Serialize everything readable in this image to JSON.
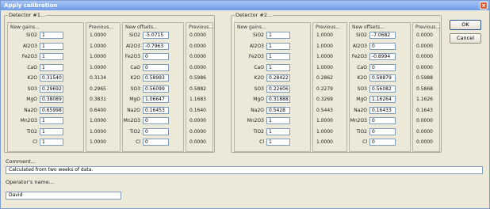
{
  "window": {
    "title": "Apply calibration"
  },
  "buttons": {
    "ok": "OK",
    "cancel": "Cancel"
  },
  "detectors": [
    {
      "title": "Detector #1...",
      "gains_header": "New gains...",
      "prev_header": "Previous...",
      "offsets_header": "New offsets...",
      "prev2_header": "Previous...",
      "rows": [
        {
          "el": "SiO2",
          "gain": "1",
          "gprev": "1.0000",
          "offset": "-5.0715",
          "oprev": "0.0000"
        },
        {
          "el": "Al2O3",
          "gain": "1",
          "gprev": "1.0000",
          "offset": "-0.7963",
          "oprev": "0.0000"
        },
        {
          "el": "Fe2O3",
          "gain": "1",
          "gprev": "1.0000",
          "offset": "0",
          "oprev": "0.0000"
        },
        {
          "el": "CaO",
          "gain": "1",
          "gprev": "1.0000",
          "offset": "0",
          "oprev": "0.0000"
        },
        {
          "el": "K2O",
          "gain": "0.31540",
          "gprev": "0.3134",
          "offset": "0.58993",
          "oprev": "0.5986"
        },
        {
          "el": "SO3",
          "gain": "0.29692",
          "gprev": "0.2965",
          "offset": "0.56099",
          "oprev": "0.5882"
        },
        {
          "el": "MgO",
          "gain": "0.38089",
          "gprev": "0.3831",
          "offset": "1.06647",
          "oprev": "1.1683"
        },
        {
          "el": "Na2O",
          "gain": "0.65998",
          "gprev": "0.6400",
          "offset": "0.16453",
          "oprev": "0.1640"
        },
        {
          "el": "Mn2O3",
          "gain": "1",
          "gprev": "1.0000",
          "offset": "0",
          "oprev": "0.0000"
        },
        {
          "el": "TiO2",
          "gain": "1",
          "gprev": "1.0000",
          "offset": "0",
          "oprev": "0.0000"
        },
        {
          "el": "Cl",
          "gain": "1",
          "gprev": "1.0000",
          "offset": "0",
          "oprev": "0.0000"
        }
      ]
    },
    {
      "title": "Detector #2...",
      "gains_header": "New gains...",
      "prev_header": "Previous...",
      "offsets_header": "New offsets...",
      "prev2_header": "Previous...",
      "rows": [
        {
          "el": "SiO2",
          "gain": "1",
          "gprev": "1.0000",
          "offset": "-7.0682",
          "oprev": "0.0000"
        },
        {
          "el": "Al2O3",
          "gain": "1",
          "gprev": "1.0000",
          "offset": "0",
          "oprev": "0.0000"
        },
        {
          "el": "Fe2O3",
          "gain": "1",
          "gprev": "1.0000",
          "offset": "-0.8994",
          "oprev": "0.0000"
        },
        {
          "el": "CaO",
          "gain": "1",
          "gprev": "1.0000",
          "offset": "0",
          "oprev": "0.0000"
        },
        {
          "el": "K2O",
          "gain": "0.28422",
          "gprev": "0.2862",
          "offset": "0.58879",
          "oprev": "0.5988"
        },
        {
          "el": "SO3",
          "gain": "0.22606",
          "gprev": "0.2279",
          "offset": "0.56082",
          "oprev": "0.5868"
        },
        {
          "el": "MgO",
          "gain": "0.31888",
          "gprev": "0.3269",
          "offset": "1.16264",
          "oprev": "1.1626"
        },
        {
          "el": "Na2O",
          "gain": "0.5428",
          "gprev": "0.5443",
          "offset": "0.16433",
          "oprev": "0.1643"
        },
        {
          "el": "Mn2O3",
          "gain": "1",
          "gprev": "1.0000",
          "offset": "0",
          "oprev": "0.0000"
        },
        {
          "el": "TiO2",
          "gain": "1",
          "gprev": "1.0000",
          "offset": "0",
          "oprev": "0.0000"
        },
        {
          "el": "Cl",
          "gain": "1",
          "gprev": "1.0000",
          "offset": "0",
          "oprev": "0.0000"
        }
      ]
    }
  ],
  "comment": {
    "label": "Comment...",
    "value": "Calculated from two weeks of data."
  },
  "operator": {
    "label": "Operator's name...",
    "value": "David"
  }
}
